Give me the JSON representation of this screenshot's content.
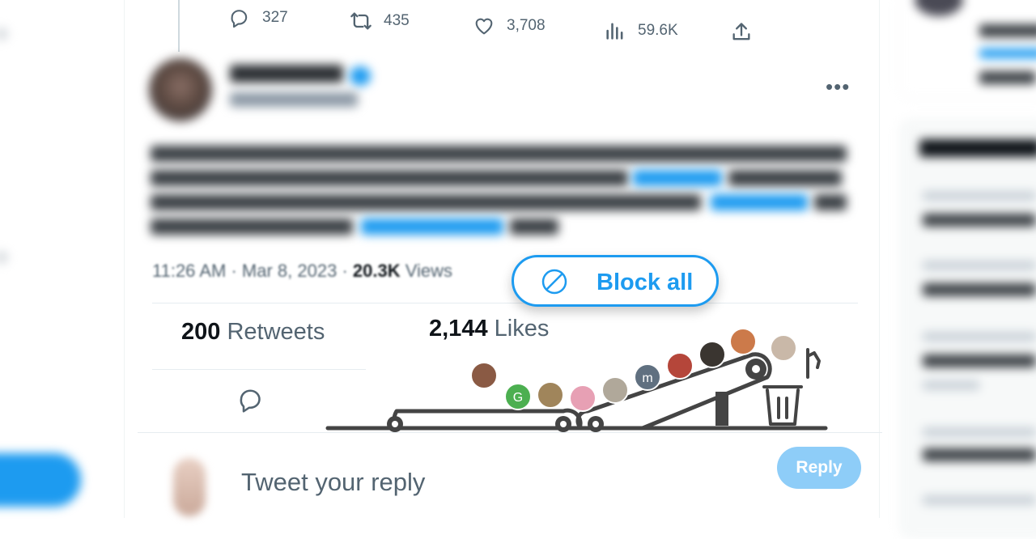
{
  "tweet_actions": {
    "replies": "327",
    "retweets": "435",
    "likes": "3,708",
    "views": "59.6K"
  },
  "tweet": {
    "time": "11:26 AM",
    "sep": "·",
    "date": "Mar 8, 2023",
    "views_count": "20.3K",
    "views_label": "Views"
  },
  "stats": {
    "retweets_count": "200",
    "retweets_label": "Retweets",
    "likes_count": "2,144",
    "likes_label": "Likes"
  },
  "reply_box": {
    "placeholder": "Tweet your reply",
    "button": "Reply"
  },
  "block": {
    "label": "Block all"
  },
  "colors": {
    "accent": "#1d9bf0",
    "reply_disabled": "#8ecdf8",
    "conveyor": "#444444"
  }
}
